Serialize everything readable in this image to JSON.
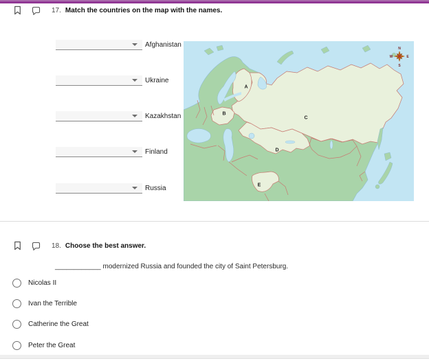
{
  "page": {
    "accent_color": "#8e3192"
  },
  "q17": {
    "number": "17.",
    "prompt": "Match the countries on the map with the names.",
    "items": [
      {
        "value": "",
        "label": "Afghanistan"
      },
      {
        "value": "",
        "label": "Ukraine"
      },
      {
        "value": "",
        "label": "Kazakhstan"
      },
      {
        "value": "",
        "label": "Finland"
      },
      {
        "value": "",
        "label": "Russia"
      }
    ],
    "map": {
      "region_labels": [
        "A",
        "B",
        "C",
        "D",
        "E"
      ],
      "compass": {
        "n": "N",
        "e": "E",
        "s": "S",
        "w": "W"
      },
      "colors": {
        "water": "#c2e5f3",
        "land": "#a9d4a9",
        "highlight": "#e9f1dc",
        "border": "#c87a72"
      }
    }
  },
  "q18": {
    "number": "18.",
    "prompt": "Choose the best answer.",
    "sentence": "____________ modernized Russia and founded the city of Saint Petersburg.",
    "options": [
      "Nicolas II",
      "Ivan the Terrible",
      "Catherine the Great",
      "Peter the Great"
    ]
  }
}
